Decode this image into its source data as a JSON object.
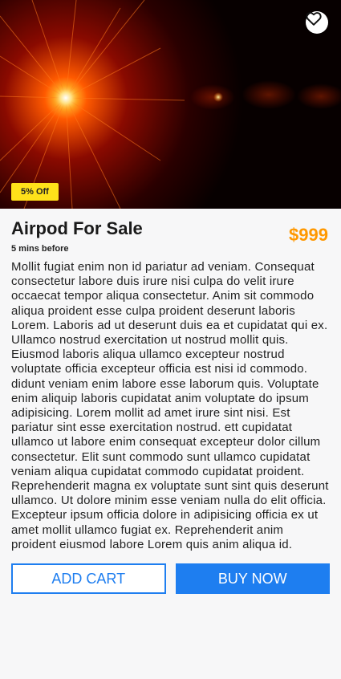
{
  "product": {
    "title": "Airpod For Sale",
    "posted": "5 mins before",
    "price": "$999",
    "discount_badge": "5% Off",
    "description": "Mollit fugiat enim non id pariatur ad veniam. Consequat consectetur labore duis irure nisi culpa do velit irure occaecat tempor aliqua consectetur. Anim sit commodo aliqua proident esse culpa proident deserunt laboris Lorem. Laboris ad ut deserunt duis ea et cupidatat qui ex. Ullamco nostrud exercitation ut nostrud mollit quis. Eiusmod laboris aliqua ullamco excepteur nostrud voluptate officia excepteur officia est nisi id commodo. didunt veniam enim labore esse laborum quis. Voluptate enim aliquip laboris cupidatat anim voluptate do ipsum adipisicing. Lorem mollit ad amet irure sint nisi. Est pariatur sint esse exercitation nostrud. ett cupidatat ullamco ut labore enim consequat excepteur dolor cillum consectetur. Elit sunt commodo sunt ullamco cupidatat veniam aliqua cupidatat commodo cupidatat proident. Reprehenderit magna ex voluptate sunt sint quis deserunt ullamco. Ut dolore minim esse veniam nulla do elit officia. Excepteur ipsum officia dolore in adipisicing officia ex ut amet mollit ullamco fugiat ex. Reprehenderit anim proident eiusmod labore Lorem quis anim aliqua id."
  },
  "actions": {
    "add_cart": "ADD CART",
    "buy_now": "BUY NOW"
  },
  "icons": {
    "favorite": "heart-outline-icon"
  },
  "colors": {
    "accent": "#1e7ef0",
    "price": "#ff9800",
    "badge": "#ffe11a"
  }
}
